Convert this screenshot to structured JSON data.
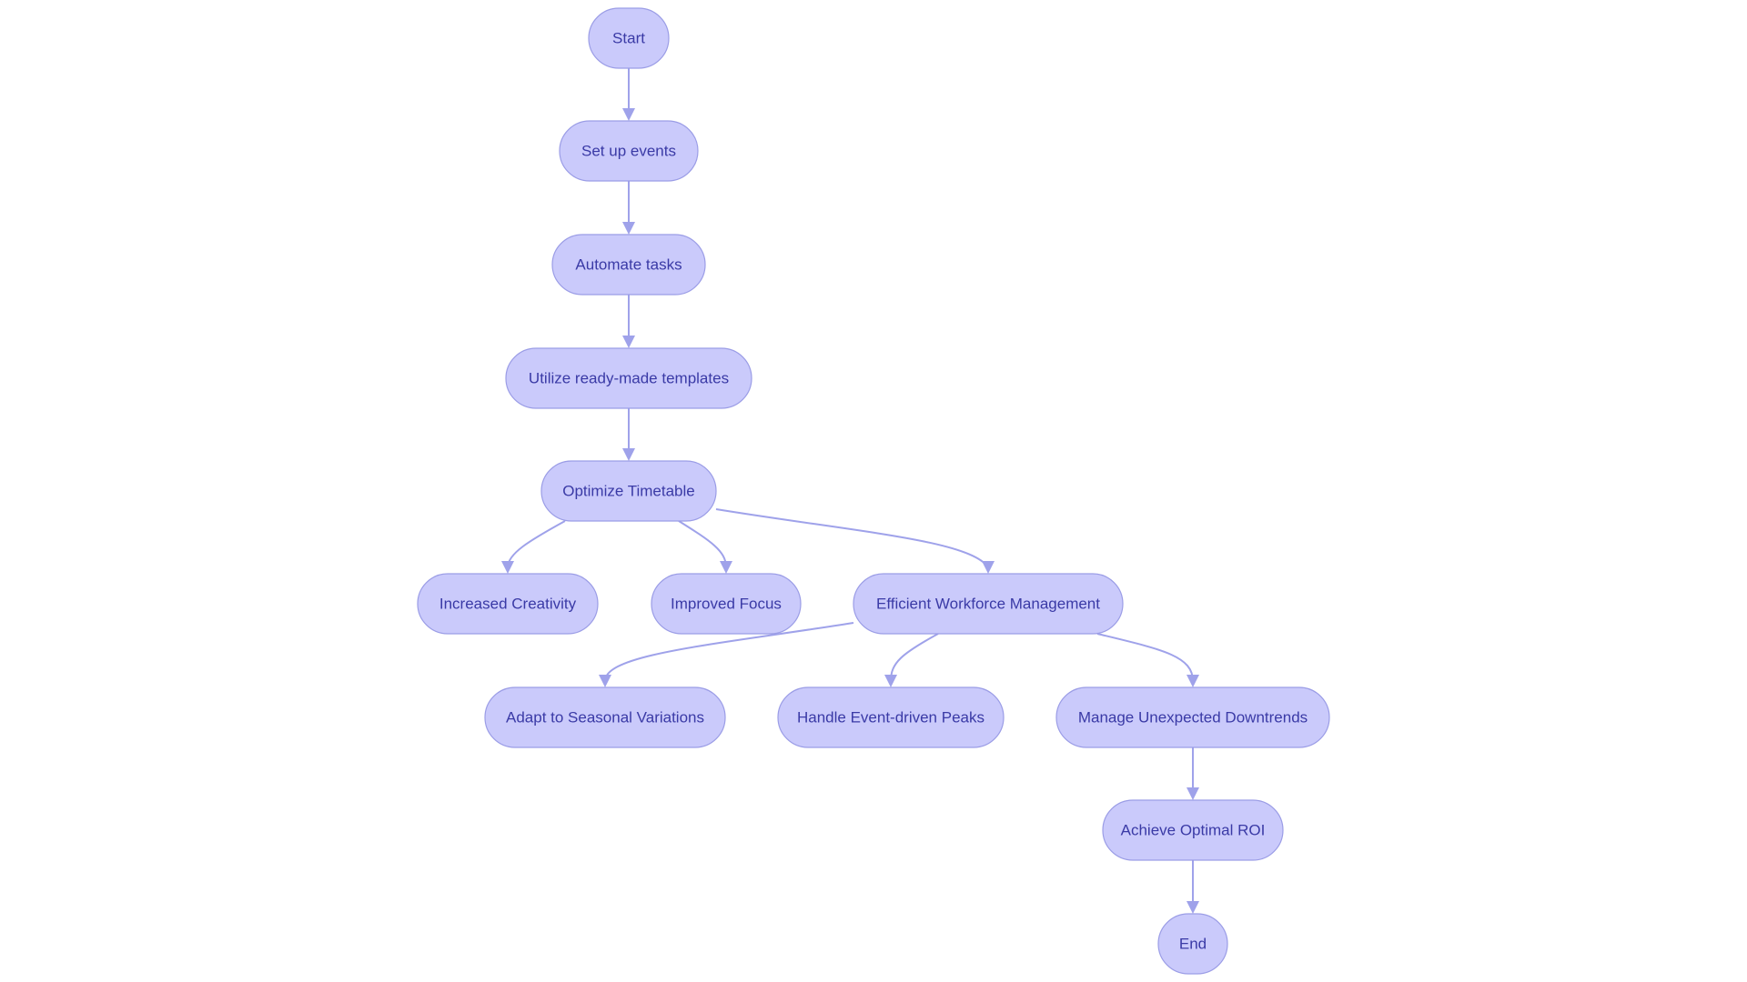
{
  "diagram": {
    "type": "flowchart",
    "direction": "top-down",
    "colors": {
      "node_fill": "#cacafb",
      "node_stroke": "#9b9de6",
      "text": "#3a3aa6",
      "edge": "#9fa2ea",
      "background": "#ffffff"
    },
    "nodes": [
      {
        "id": "start",
        "label": "Start"
      },
      {
        "id": "setup",
        "label": "Set up events"
      },
      {
        "id": "automate",
        "label": "Automate tasks"
      },
      {
        "id": "templates",
        "label": "Utilize ready-made templates"
      },
      {
        "id": "optimize",
        "label": "Optimize Timetable"
      },
      {
        "id": "creativity",
        "label": "Increased Creativity"
      },
      {
        "id": "focus",
        "label": "Improved Focus"
      },
      {
        "id": "workforce",
        "label": "Efficient Workforce Management"
      },
      {
        "id": "seasonal",
        "label": "Adapt to Seasonal Variations"
      },
      {
        "id": "peaks",
        "label": "Handle Event-driven Peaks"
      },
      {
        "id": "downtrends",
        "label": "Manage Unexpected Downtrends"
      },
      {
        "id": "roi",
        "label": "Achieve Optimal ROI"
      },
      {
        "id": "end",
        "label": "End"
      }
    ],
    "edges": [
      {
        "from": "start",
        "to": "setup"
      },
      {
        "from": "setup",
        "to": "automate"
      },
      {
        "from": "automate",
        "to": "templates"
      },
      {
        "from": "templates",
        "to": "optimize"
      },
      {
        "from": "optimize",
        "to": "creativity"
      },
      {
        "from": "optimize",
        "to": "focus"
      },
      {
        "from": "optimize",
        "to": "workforce"
      },
      {
        "from": "workforce",
        "to": "seasonal"
      },
      {
        "from": "workforce",
        "to": "peaks"
      },
      {
        "from": "workforce",
        "to": "downtrends"
      },
      {
        "from": "downtrends",
        "to": "roi"
      },
      {
        "from": "roi",
        "to": "end"
      }
    ]
  }
}
